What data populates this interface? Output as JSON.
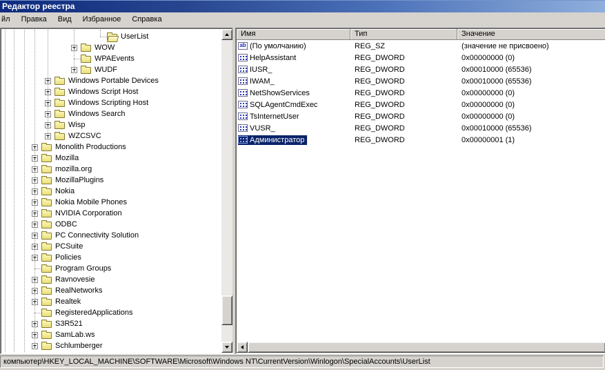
{
  "window": {
    "title": "Редактор реестра"
  },
  "menu": {
    "items": [
      "йл",
      "Правка",
      "Вид",
      "Избранное",
      "Справка"
    ]
  },
  "icons": {
    "sz_glyph": "ab"
  },
  "colors": {
    "selection": "#0a246a",
    "titlebar_left": "#0d2a7d",
    "titlebar_right": "#8fafdc",
    "chrome_gray": "#d6d3ce",
    "folder_yellow": "#f0e68c",
    "value_icon_blue": "#2a35b0"
  },
  "tree": {
    "items": [
      {
        "label": "UserList",
        "level": 7,
        "expand": "none",
        "folder": "open"
      },
      {
        "label": "WOW",
        "level": 5,
        "expand": "plus",
        "folder": "closed"
      },
      {
        "label": "WPAEvents",
        "level": 5,
        "expand": "none",
        "folder": "closed"
      },
      {
        "label": "WUDF",
        "level": 5,
        "expand": "plus",
        "folder": "closed"
      },
      {
        "label": "Windows Portable Devices",
        "level": 3,
        "expand": "plus",
        "folder": "closed"
      },
      {
        "label": "Windows Script Host",
        "level": 3,
        "expand": "plus",
        "folder": "closed"
      },
      {
        "label": "Windows Scripting Host",
        "level": 3,
        "expand": "plus",
        "folder": "closed"
      },
      {
        "label": "Windows Search",
        "level": 3,
        "expand": "plus",
        "folder": "closed"
      },
      {
        "label": "Wisp",
        "level": 3,
        "expand": "plus",
        "folder": "closed"
      },
      {
        "label": "WZCSVC",
        "level": 3,
        "expand": "plus",
        "folder": "closed"
      },
      {
        "label": "Monolith Productions",
        "level": 2,
        "expand": "plus",
        "folder": "closed"
      },
      {
        "label": "Mozilla",
        "level": 2,
        "expand": "plus",
        "folder": "closed"
      },
      {
        "label": "mozilla.org",
        "level": 2,
        "expand": "plus",
        "folder": "closed"
      },
      {
        "label": "MozillaPlugins",
        "level": 2,
        "expand": "plus",
        "folder": "closed"
      },
      {
        "label": "Nokia",
        "level": 2,
        "expand": "plus",
        "folder": "closed"
      },
      {
        "label": "Nokia Mobile Phones",
        "level": 2,
        "expand": "plus",
        "folder": "closed"
      },
      {
        "label": "NVIDIA Corporation",
        "level": 2,
        "expand": "plus",
        "folder": "closed"
      },
      {
        "label": "ODBC",
        "level": 2,
        "expand": "plus",
        "folder": "closed"
      },
      {
        "label": "PC Connectivity Solution",
        "level": 2,
        "expand": "plus",
        "folder": "closed"
      },
      {
        "label": "PCSuite",
        "level": 2,
        "expand": "plus",
        "folder": "closed"
      },
      {
        "label": "Policies",
        "level": 2,
        "expand": "plus",
        "folder": "closed"
      },
      {
        "label": "Program Groups",
        "level": 2,
        "expand": "none",
        "folder": "closed"
      },
      {
        "label": "Ravnovesie",
        "level": 2,
        "expand": "plus",
        "folder": "closed"
      },
      {
        "label": "RealNetworks",
        "level": 2,
        "expand": "plus",
        "folder": "closed"
      },
      {
        "label": "Realtek",
        "level": 2,
        "expand": "plus",
        "folder": "closed"
      },
      {
        "label": "RegisteredApplications",
        "level": 2,
        "expand": "none",
        "folder": "closed"
      },
      {
        "label": "S3R521",
        "level": 2,
        "expand": "plus",
        "folder": "closed"
      },
      {
        "label": "SamLab.ws",
        "level": 2,
        "expand": "plus",
        "folder": "closed"
      },
      {
        "label": "Schlumberger",
        "level": 2,
        "expand": "plus",
        "folder": "closed"
      }
    ]
  },
  "list": {
    "columns": [
      "Имя",
      "Тип",
      "Значение"
    ],
    "rows": [
      {
        "icon": "sz",
        "name": "(По умолчанию)",
        "type": "REG_SZ",
        "value": "(значение не присвоено)",
        "selected": false
      },
      {
        "icon": "dword",
        "name": "HelpAssistant",
        "type": "REG_DWORD",
        "value": "0x00000000 (0)",
        "selected": false
      },
      {
        "icon": "dword",
        "name": "IUSR_",
        "type": "REG_DWORD",
        "value": "0x00010000 (65536)",
        "selected": false
      },
      {
        "icon": "dword",
        "name": "IWAM_",
        "type": "REG_DWORD",
        "value": "0x00010000 (65536)",
        "selected": false
      },
      {
        "icon": "dword",
        "name": "NetShowServices",
        "type": "REG_DWORD",
        "value": "0x00000000 (0)",
        "selected": false
      },
      {
        "icon": "dword",
        "name": "SQLAgentCmdExec",
        "type": "REG_DWORD",
        "value": "0x00000000 (0)",
        "selected": false
      },
      {
        "icon": "dword",
        "name": "TsInternetUser",
        "type": "REG_DWORD",
        "value": "0x00000000 (0)",
        "selected": false
      },
      {
        "icon": "dword",
        "name": "VUSR_",
        "type": "REG_DWORD",
        "value": "0x00010000 (65536)",
        "selected": false
      },
      {
        "icon": "dword",
        "name": "Администратор",
        "type": "REG_DWORD",
        "value": "0x00000001 (1)",
        "selected": true
      }
    ]
  },
  "statusbar": {
    "path": "компьютер\\HKEY_LOCAL_MACHINE\\SOFTWARE\\Microsoft\\Windows NT\\CurrentVersion\\Winlogon\\SpecialAccounts\\UserList"
  }
}
